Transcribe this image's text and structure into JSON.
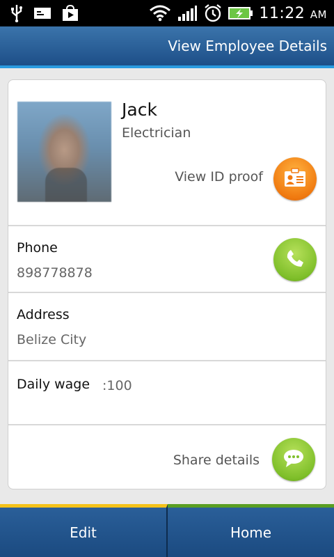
{
  "status_bar": {
    "time": "11:22",
    "ampm": "AM",
    "icons": [
      "usb-icon",
      "sim-card-icon",
      "play-store-icon",
      "wifi-icon",
      "signal-icon",
      "alarm-icon",
      "battery-charging-icon"
    ]
  },
  "header": {
    "title": "View Employee Details"
  },
  "employee": {
    "name": "Jack",
    "job": "Electrician",
    "id_label": "View ID proof",
    "phone_label": "Phone",
    "phone_value": "898778878",
    "address_label": "Address",
    "address_value": "Belize City",
    "wage_label": "Daily wage",
    "wage_value": ":100",
    "share_label": "Share details"
  },
  "bottom_bar": {
    "edit_label": "Edit",
    "home_label": "Home"
  },
  "colors": {
    "accent_blue": "#2a9be0",
    "orange": "#f07a10",
    "green": "#7fbf2a",
    "edit_strip": "#f4c21a",
    "home_strip": "#5a9e22"
  }
}
